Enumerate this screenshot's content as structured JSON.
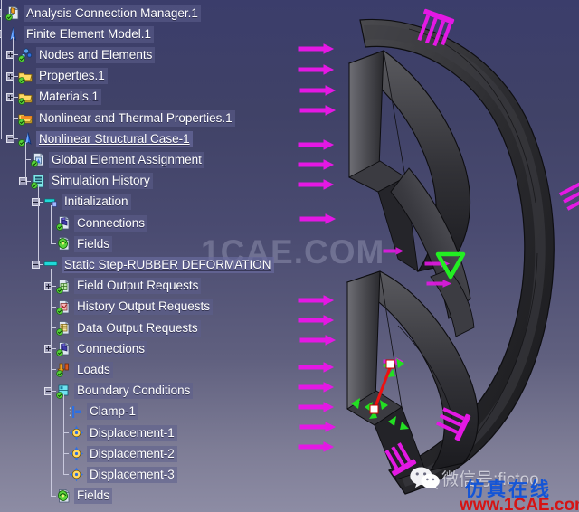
{
  "app": {
    "title": "Analysis Connection Manager.1",
    "background_top": "#3b3d6b",
    "background_bottom": "#8d8ca4"
  },
  "viewport": {
    "part_color": "#2b2b2e",
    "load_arrow_color": "#e418e4",
    "restraint_color": "#22e022",
    "link_color": "#ee1111",
    "marker_triangle_color": "#22ee22",
    "marker_triangle_name": "green-down-triangle-marker"
  },
  "watermarks": {
    "center": "1CAE.COM",
    "wechat_id": "微信号:fictoo",
    "brand_cn": "仿真在线",
    "site": "www.1CAE.com",
    "brand_color": "#1455d6",
    "site_color": "#d61414"
  },
  "tree": {
    "nodes": [
      {
        "label": "Analysis Connection Manager.1",
        "icon": "analysis-connection-manager-icon",
        "depth": 0,
        "toggle": "plus",
        "selected": false
      },
      {
        "label": "Finite Element Model.1",
        "icon": "finite-element-model-icon",
        "depth": 0,
        "toggle": "minus",
        "selected": false
      },
      {
        "label": "Nodes and Elements",
        "icon": "nodes-and-elements-icon",
        "depth": 1,
        "toggle": "plus",
        "selected": false
      },
      {
        "label": "Properties.1",
        "icon": "properties-folder-icon",
        "depth": 1,
        "toggle": "plus",
        "selected": false
      },
      {
        "label": "Materials.1",
        "icon": "materials-folder-icon",
        "depth": 1,
        "toggle": "plus",
        "selected": false
      },
      {
        "label": "Nonlinear and Thermal Properties.1",
        "icon": "nonlinear-thermal-properties-icon",
        "depth": 1,
        "toggle": "none",
        "selected": false
      },
      {
        "label": "Nonlinear Structural Case-1",
        "icon": "nonlinear-structural-case-icon",
        "depth": 1,
        "toggle": "minus",
        "selected": true
      },
      {
        "label": "Global Element Assignment",
        "icon": "global-element-assignment-icon",
        "depth": 2,
        "toggle": "none",
        "selected": false
      },
      {
        "label": "Simulation History",
        "icon": "simulation-history-icon",
        "depth": 2,
        "toggle": "minus",
        "selected": false
      },
      {
        "label": "Initialization",
        "icon": "initialization-step-icon",
        "depth": 3,
        "toggle": "minus",
        "selected": false
      },
      {
        "label": "Connections",
        "icon": "connections-icon",
        "depth": 4,
        "toggle": "none",
        "selected": false
      },
      {
        "label": "Fields",
        "icon": "fields-icon",
        "depth": 4,
        "toggle": "none",
        "selected": false
      },
      {
        "label": "Static Step-RUBBER DEFORMATION",
        "icon": "static-step-icon",
        "depth": 3,
        "toggle": "minus",
        "selected": true
      },
      {
        "label": "Field Output Requests",
        "icon": "field-output-requests-icon",
        "depth": 4,
        "toggle": "plus",
        "selected": false
      },
      {
        "label": "History Output Requests",
        "icon": "history-output-requests-icon",
        "depth": 4,
        "toggle": "none",
        "selected": false
      },
      {
        "label": "Data Output Requests",
        "icon": "data-output-requests-icon",
        "depth": 4,
        "toggle": "none",
        "selected": false
      },
      {
        "label": "Connections",
        "icon": "connections-icon",
        "depth": 4,
        "toggle": "plus",
        "selected": false
      },
      {
        "label": "Loads",
        "icon": "loads-icon",
        "depth": 4,
        "toggle": "none",
        "selected": false
      },
      {
        "label": "Boundary Conditions",
        "icon": "boundary-conditions-icon",
        "depth": 4,
        "toggle": "minus",
        "selected": false
      },
      {
        "label": "Clamp-1",
        "icon": "clamp-icon",
        "depth": 5,
        "toggle": "none",
        "selected": false
      },
      {
        "label": "Displacement-1",
        "icon": "displacement-icon",
        "depth": 5,
        "toggle": "none",
        "selected": false
      },
      {
        "label": "Displacement-2",
        "icon": "displacement-icon",
        "depth": 5,
        "toggle": "none",
        "selected": false
      },
      {
        "label": "Displacement-3",
        "icon": "displacement-icon",
        "depth": 5,
        "toggle": "none",
        "selected": false
      },
      {
        "label": "Fields",
        "icon": "fields-icon",
        "depth": 4,
        "toggle": "none",
        "selected": false
      }
    ]
  }
}
